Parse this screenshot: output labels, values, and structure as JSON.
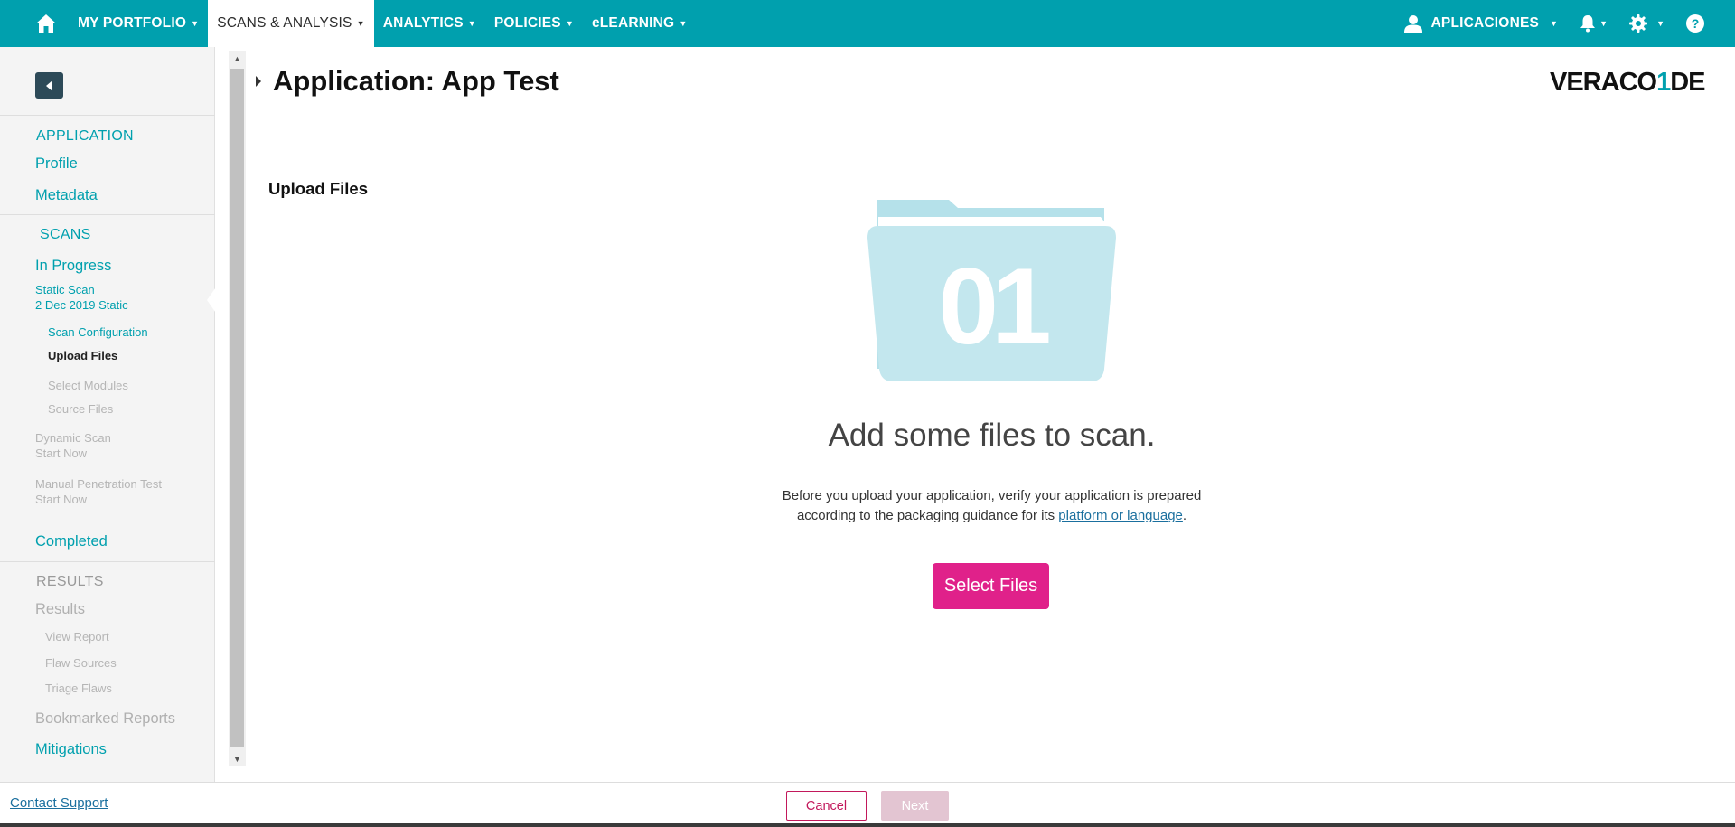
{
  "nav": {
    "items": [
      {
        "label": "MY PORTFOLIO",
        "active": false
      },
      {
        "label": "SCANS & ANALYSIS",
        "active": true
      },
      {
        "label": "ANALYTICS",
        "active": false
      },
      {
        "label": "POLICIES",
        "active": false
      },
      {
        "label": "eLEARNING",
        "active": false
      }
    ],
    "user_label": "APLICACIONES",
    "icons": [
      "home-icon",
      "user-icon",
      "bell-icon",
      "gear-icon",
      "help-icon"
    ],
    "accent_color": "#00a0ae"
  },
  "sidebar": {
    "application_heading": "APPLICATION",
    "profile": "Profile",
    "metadata": "Metadata",
    "scans_heading": "SCANS",
    "in_progress": "In Progress",
    "static_scan_title": "Static Scan",
    "static_scan_date": "2 Dec 2019 Static",
    "steps": [
      {
        "label": "Scan Configuration",
        "state": "link"
      },
      {
        "label": "Upload Files",
        "state": "active"
      },
      {
        "label": "Select Modules",
        "state": "disabled"
      },
      {
        "label": "Source Files",
        "state": "disabled"
      }
    ],
    "dynamic_scan_title": "Dynamic Scan",
    "dynamic_scan_status": "Start Now",
    "manual_test_title": "Manual Penetration Test",
    "manual_test_status": "Start Now",
    "completed": "Completed",
    "results_heading": "RESULTS",
    "results": "Results",
    "results_items": [
      "View Report",
      "Flaw Sources",
      "Triage Flaws"
    ],
    "bookmarked": "Bookmarked Reports",
    "mitigations": "Mitigations"
  },
  "main": {
    "title": "Application: App Test",
    "logo_text_a": "VERACO",
    "logo_text_b": "1",
    "logo_text_c": "DE",
    "section_heading": "Upload Files",
    "empty_title": "Add some files to scan.",
    "help_line1": "Before you upload your application, verify your application is prepared",
    "help_line2": "according to the packaging guidance for its ",
    "help_link": "platform or language",
    "help_end": ".",
    "folder_glyph": "01",
    "select_button": "Select Files",
    "select_color": "#e0218a"
  },
  "footer": {
    "contact": "Contact Support",
    "cancel": "Cancel",
    "next": "Next"
  }
}
